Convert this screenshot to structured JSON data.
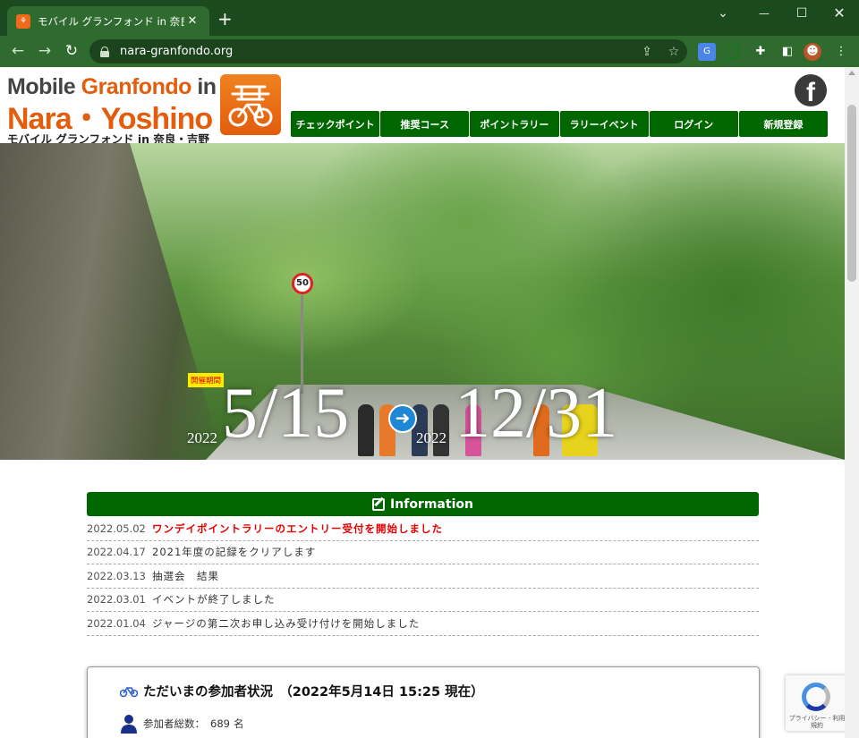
{
  "browser": {
    "tab_title": "モバイル グランフォンド in 奈良･吉野",
    "url": "nara-granfondo.org"
  },
  "logo": {
    "line1_mobile": "Mobile",
    "line1_granfondo": "Granfondo",
    "line1_in": "in",
    "line2": "Nara・Yoshino",
    "line3": "モバイル グランフォンド in 奈良・吉野"
  },
  "nav": [
    {
      "label": "チェックポイント"
    },
    {
      "label": "推奨コース"
    },
    {
      "label": "ポイントラリー"
    },
    {
      "label": "ラリーイベント"
    },
    {
      "label": "ログイン"
    },
    {
      "label": "新規登録"
    }
  ],
  "hero": {
    "tag": "開催期間",
    "sign": "50",
    "start_year": "2022",
    "start_date": "5/15",
    "end_year": "2022",
    "end_date": "12/31"
  },
  "info": {
    "title": "Information",
    "items": [
      {
        "date": "2022.05.02",
        "text": "ワンデイポイントラリーのエントリー受付を開始しました",
        "highlight": true
      },
      {
        "date": "2022.04.17",
        "text": "2021年度の記録をクリアします",
        "highlight": false
      },
      {
        "date": "2022.03.13",
        "text": "抽選会　結果",
        "highlight": false
      },
      {
        "date": "2022.03.01",
        "text": "イベントが終了しました",
        "highlight": false
      },
      {
        "date": "2022.01.04",
        "text": "ジャージの第二次お申し込み受け付けを開始しました",
        "highlight": false
      }
    ]
  },
  "status": {
    "title": "ただいまの参加者状況　（2022年5月14日 15:25 現在）",
    "total_label": "参加者総数：",
    "total_count": "689",
    "total_unit": "名"
  },
  "recaptcha": {
    "text": "プライバシー - 利用規約"
  },
  "colors": {
    "brand_green": "#006600",
    "brand_orange": "#e25d0c",
    "highlight_red": "#e50000"
  }
}
